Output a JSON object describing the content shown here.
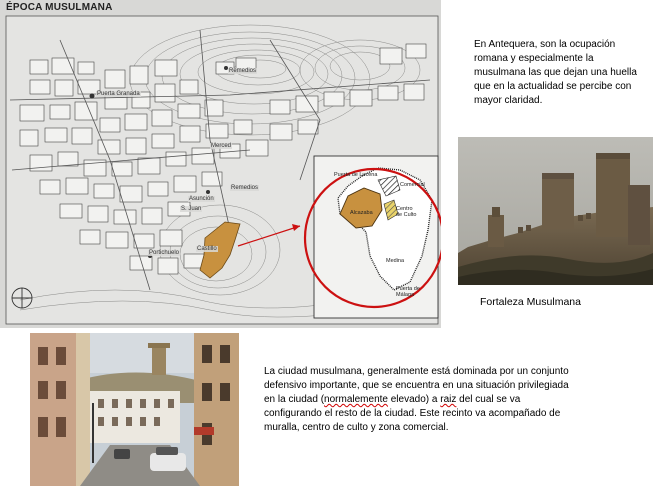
{
  "map": {
    "title": "ÉPOCA MUSULMANA",
    "labels": {
      "puerta_granada": "Puerta Granada",
      "merced": "Merced",
      "remedios": "Remedios",
      "portichuelo": "Portichuelo",
      "castillo": "Castillo",
      "asunción": "Asunción",
      "remedios_small": "Remedios",
      "san_juan": "S. Juan"
    },
    "inset": {
      "puerta_lucena": "Puerta de Lucena",
      "comercial": "Comercial",
      "alcazaba": "Alcazaba",
      "centro_culto": "Centro de Culto",
      "medina": "Medina",
      "puerta_malaga": "Puerta de Málaga"
    }
  },
  "intro_text": "En Antequera, son la ocupación romana y especialmente la musulmana las que dejan una huella que en la actualidad se percibe con mayor claridad.",
  "fortress_caption": "Fortaleza Musulmana",
  "body": {
    "p1": "La ciudad musulmana, generalmente está dominada por un conjunto defensivo importante, que se encuentra en una situación privilegiada en la ciudad (",
    "p_wavy1": "normalemente",
    "p2": " elevado) a ",
    "p_wavy2": "raiz",
    "p3": " del cual se va configurando el resto de la ciudad. Este recinto va acompañado de muralla, centro de culto y zona comercial."
  },
  "colors": {
    "alcazaba_fill": "#c8913f",
    "circle_stroke": "#cc1111",
    "map_bg": "#d8d8d6"
  }
}
